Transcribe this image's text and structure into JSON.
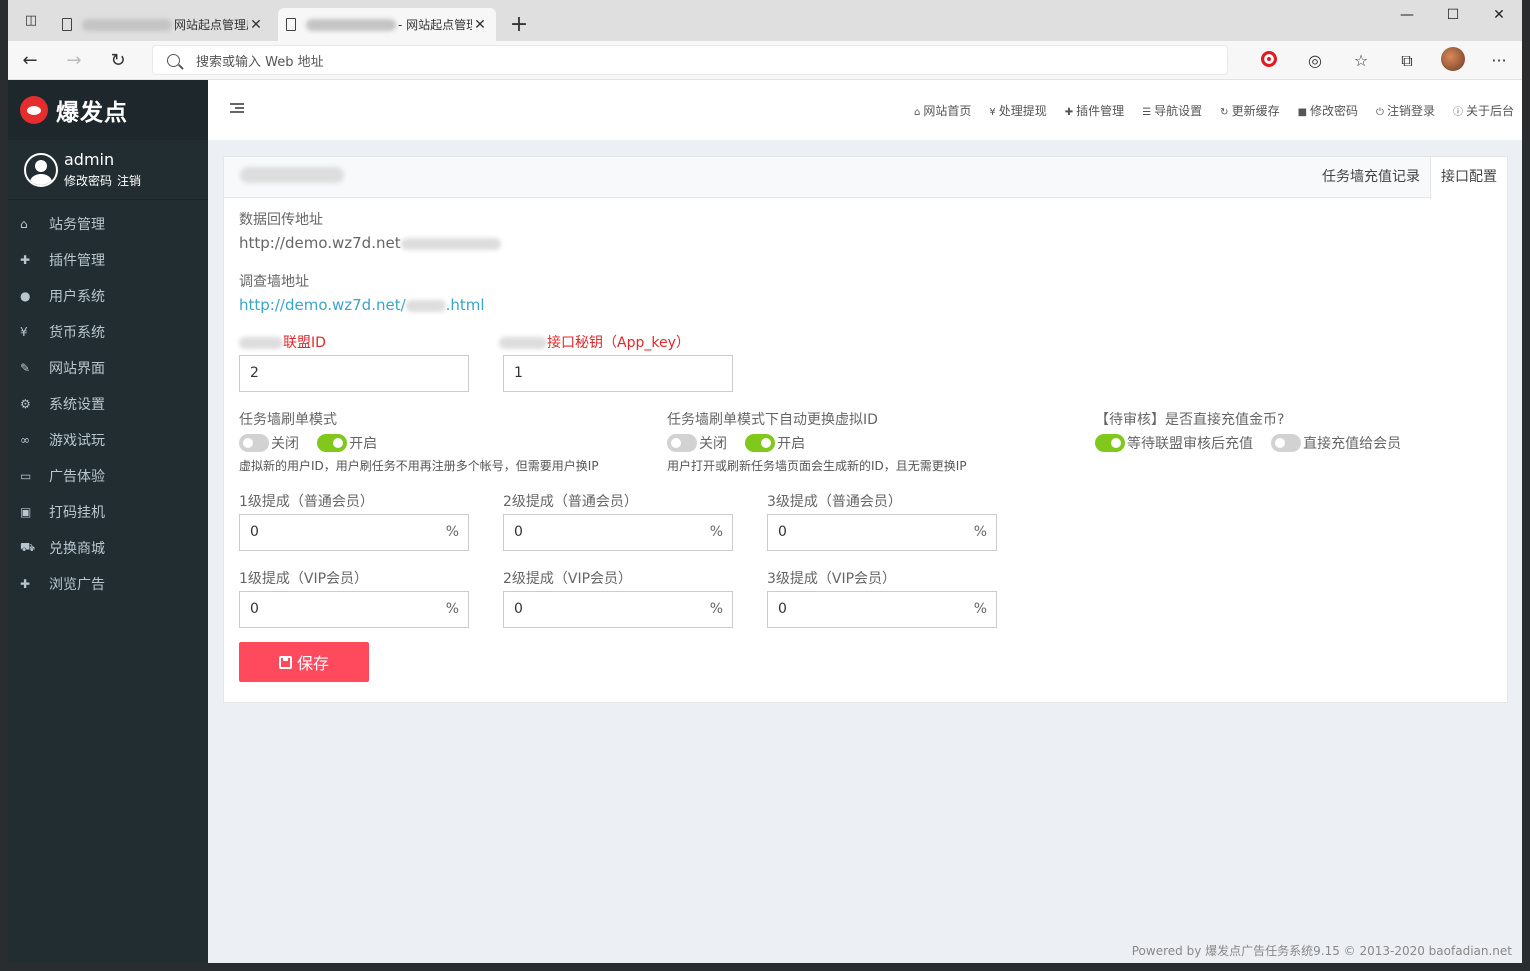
{
  "browser": {
    "tabs": [
      {
        "title": "网站起点管理后"
      },
      {
        "title": "- 网站起点管理后"
      }
    ],
    "address_placeholder": "搜索或输入 Web 地址"
  },
  "sidebar": {
    "brand": "爆发点",
    "user": {
      "name": "admin",
      "change_pwd": "修改密码",
      "logout": "注销"
    },
    "items": [
      {
        "label": "站务管理",
        "icon": "home-icon"
      },
      {
        "label": "插件管理",
        "icon": "puzzle-icon"
      },
      {
        "label": "用户系统",
        "icon": "user-icon"
      },
      {
        "label": "货币系统",
        "icon": "yen-icon"
      },
      {
        "label": "网站界面",
        "icon": "brush-icon"
      },
      {
        "label": "系统设置",
        "icon": "gears-icon"
      },
      {
        "label": "游戏试玩",
        "icon": "gamepad-icon"
      },
      {
        "label": "广告体验",
        "icon": "monitor-icon"
      },
      {
        "label": "打码挂机",
        "icon": "image-icon"
      },
      {
        "label": "兑换商城",
        "icon": "cart-icon"
      },
      {
        "label": "浏览广告",
        "icon": "plus-icon"
      }
    ]
  },
  "topnav": [
    {
      "label": "网站首页",
      "icon": "home-icon"
    },
    {
      "label": "处理提现",
      "icon": "yen-icon"
    },
    {
      "label": "插件管理",
      "icon": "puzzle-icon"
    },
    {
      "label": "导航设置",
      "icon": "sliders-icon"
    },
    {
      "label": "更新缓存",
      "icon": "refresh-icon"
    },
    {
      "label": "修改密码",
      "icon": "lock-icon"
    },
    {
      "label": "注销登录",
      "icon": "power-icon"
    },
    {
      "label": "关于后台",
      "icon": "info-icon"
    }
  ],
  "panel": {
    "tabs": [
      {
        "label": "任务墙充值记录"
      },
      {
        "label": "接口配置"
      }
    ],
    "callback_label": "数据回传地址",
    "callback_value": "http://demo.wz7d.net",
    "survey_label": "调查墙地址",
    "survey_value_prefix": "http://demo.wz7d.net/",
    "survey_value_suffix": ".html",
    "union_id_label": "联盟ID",
    "union_id_value": "2",
    "app_key_label": "接口秘钥（App_key）",
    "app_key_value": "1",
    "mode": {
      "label": "任务墙刷单模式",
      "off": "关闭",
      "on": "开启",
      "hint": "虚拟新的用户ID，用户刷任务不用再注册多个帐号，但需要用户换IP"
    },
    "auto_id": {
      "label": "任务墙刷单模式下自动更换虚拟ID",
      "off": "关闭",
      "on": "开启",
      "hint": "用户打开或刷新任务墙页面会生成新的ID，且无需更换IP"
    },
    "pending": {
      "label": "【待审核】是否直接充值金币?",
      "opt1": "等待联盟审核后充值",
      "opt2": "直接充值给会员"
    },
    "commission": [
      {
        "label": "1级提成（普通会员）",
        "value": "0"
      },
      {
        "label": "2级提成（普通会员）",
        "value": "0"
      },
      {
        "label": "3级提成（普通会员）",
        "value": "0"
      },
      {
        "label": "1级提成（VIP会员）",
        "value": "0"
      },
      {
        "label": "2级提成（VIP会员）",
        "value": "0"
      },
      {
        "label": "3级提成（VIP会员）",
        "value": "0"
      }
    ],
    "percent": "%",
    "save_label": "保存"
  },
  "footer": "Powered by 爆发点广告任务系统9.15 © 2013-2020 baofadian.net",
  "colors": {
    "sidebar": "#222d32",
    "accent_switch": "#80c91c",
    "save": "#ff4a5e",
    "link": "#3aa5c9",
    "red_label": "#e0292c"
  }
}
